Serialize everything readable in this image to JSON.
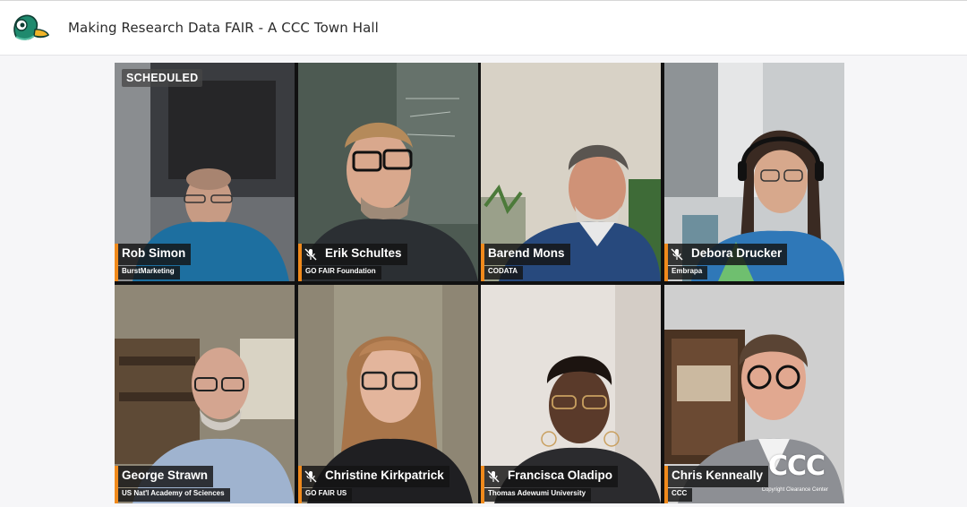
{
  "header": {
    "title": "Making Research Data FAIR - A CCC Town Hall",
    "logo_icon": "duck-logo-icon"
  },
  "status_badge": "SCHEDULED",
  "brand_overlay": {
    "mark": "CCC",
    "text": "Copyright Clearance Center"
  },
  "colors": {
    "accent": "#f08a1c"
  },
  "participants": [
    {
      "name": "Rob Simon",
      "org": "BurstMarketing",
      "muted": false
    },
    {
      "name": "Erik Schultes",
      "org": "GO FAIR Foundation",
      "muted": true
    },
    {
      "name": "Barend Mons",
      "org": "CODATA",
      "muted": false
    },
    {
      "name": "Debora Drucker",
      "org": "Embrapa",
      "muted": true
    },
    {
      "name": "George Strawn",
      "org": "US Nat'l Academy of Sciences",
      "muted": false
    },
    {
      "name": "Christine Kirkpatrick",
      "org": "GO FAIR US",
      "muted": true
    },
    {
      "name": "Francisca Oladipo",
      "org": "Thomas Adewumi University",
      "muted": true
    },
    {
      "name": "Chris Kenneally",
      "org": "CCC",
      "muted": false
    }
  ]
}
